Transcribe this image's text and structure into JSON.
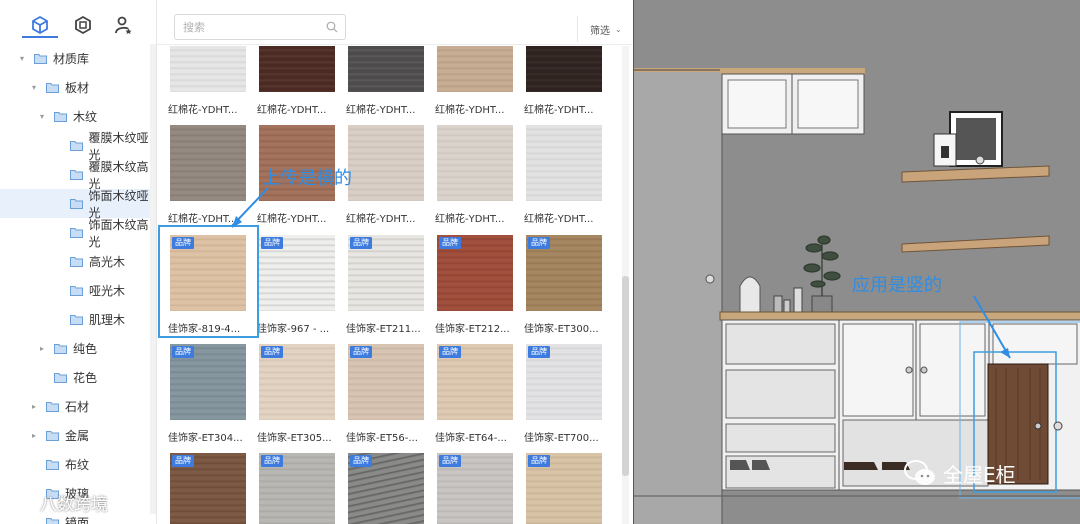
{
  "sidebar": {
    "tabs": [
      {
        "icon": "cube-icon",
        "active": true
      },
      {
        "icon": "hexagon-box-icon",
        "active": false
      },
      {
        "icon": "person-star-icon",
        "active": false
      }
    ],
    "tree": [
      {
        "label": "材质库",
        "level": 0,
        "arrow": "down"
      },
      {
        "label": "板材",
        "level": 1,
        "arrow": "down"
      },
      {
        "label": "木纹",
        "level": 2,
        "arrow": "down"
      },
      {
        "label": "覆膜木纹哑光",
        "level": 3,
        "arrow": ""
      },
      {
        "label": "覆膜木纹高光",
        "level": 3,
        "arrow": ""
      },
      {
        "label": "饰面木纹哑光",
        "level": 3,
        "arrow": "",
        "selected": true
      },
      {
        "label": "饰面木纹高光",
        "level": 3,
        "arrow": ""
      },
      {
        "label": "高光木",
        "level": 3,
        "arrow": ""
      },
      {
        "label": "哑光木",
        "level": 3,
        "arrow": ""
      },
      {
        "label": "肌理木",
        "level": 3,
        "arrow": ""
      },
      {
        "label": "纯色",
        "level": 2,
        "arrow": "right"
      },
      {
        "label": "花色",
        "level": 2,
        "arrow": ""
      },
      {
        "label": "石材",
        "level": 1,
        "arrow": "right"
      },
      {
        "label": "金属",
        "level": 1,
        "arrow": "right"
      },
      {
        "label": "布纹",
        "level": 1,
        "arrow": ""
      },
      {
        "label": "玻璃",
        "level": 1,
        "arrow": ""
      },
      {
        "label": "镜面",
        "level": 1,
        "arrow": ""
      }
    ]
  },
  "search": {
    "placeholder": "搜索",
    "value": ""
  },
  "filter": {
    "label": "筛选"
  },
  "badge_text": "品牌",
  "materials": {
    "rows": [
      [
        {
          "label": "红棉花-YDHT...",
          "color": "#e6e6e6",
          "grain": "#d6d6d6",
          "badge": false
        },
        {
          "label": "红棉花-YDHT...",
          "color": "#4a2a22",
          "grain": "#5c3a30",
          "badge": false
        },
        {
          "label": "红棉花-YDHT...",
          "color": "#4d4b4c",
          "grain": "#5e5c5d",
          "badge": false
        },
        {
          "label": "红棉花-YDHT...",
          "color": "#c7ad94",
          "grain": "#b89d83",
          "badge": false
        },
        {
          "label": "红棉花-YDHT...",
          "color": "#2e2320",
          "grain": "#3c302c",
          "badge": false
        }
      ],
      [
        {
          "label": "红棉花-YDHT...",
          "color": "#948a82",
          "grain": "#857b73",
          "badge": false
        },
        {
          "label": "红棉花-YDHT...",
          "color": "#a3735d",
          "grain": "#93634e",
          "badge": false
        },
        {
          "label": "红棉花-YDHT...",
          "color": "#d9cfc7",
          "grain": "#cbc1b9",
          "badge": false
        },
        {
          "label": "红棉花-YDHT...",
          "color": "#d9d3cc",
          "grain": "#ccc6bf",
          "badge": false
        },
        {
          "label": "红棉花-YDHT...",
          "color": "#e2e2e2",
          "grain": "#d4d4d4",
          "badge": false
        }
      ],
      [
        {
          "label": "佳饰家-819-4...",
          "color": "#dec2a5",
          "grain": "#cfb294",
          "badge": true
        },
        {
          "label": "佳饰家-967 - ...",
          "color": "#efefed",
          "grain": "#d0d0ce",
          "badge": true
        },
        {
          "label": "佳饰家-ET211...",
          "color": "#e8e6e3",
          "grain": "#cfcbc6",
          "badge": true
        },
        {
          "label": "佳饰家-ET212...",
          "color": "#a1503e",
          "grain": "#914232",
          "badge": true
        },
        {
          "label": "佳饰家-ET300...",
          "color": "#a58861",
          "grain": "#957851",
          "badge": true
        }
      ],
      [
        {
          "label": "佳饰家-ET304...",
          "color": "#8797a0",
          "grain": "#778790",
          "badge": true
        },
        {
          "label": "佳饰家-ET305...",
          "color": "#e2d3c2",
          "grain": "#d3c4b3",
          "badge": true
        },
        {
          "label": "佳饰家-ET56-...",
          "color": "#d7c4b2",
          "grain": "#c8b5a3",
          "badge": true
        },
        {
          "label": "佳饰家-ET64-...",
          "color": "#dec9b2",
          "grain": "#cfbaa3",
          "badge": true
        },
        {
          "label": "佳饰家-ET700...",
          "color": "#e2e2e4",
          "grain": "#d4d4d6",
          "badge": true
        }
      ],
      [
        {
          "label": "",
          "color": "#7c5a45",
          "grain": "#6c4a35",
          "badge": true
        },
        {
          "label": "",
          "color": "#b9b7b4",
          "grain": "#a9a7a4",
          "badge": true
        },
        {
          "label": "",
          "color": "#8a8a88",
          "grain": "#5f5f5d",
          "badge": true
        },
        {
          "label": "",
          "color": "#c9c5c3",
          "grain": "#b9b5b3",
          "badge": true
        },
        {
          "label": "",
          "color": "#d8c3a7",
          "grain": "#c8b397",
          "badge": true
        }
      ]
    ]
  },
  "annotations": {
    "upload": "上传是横的",
    "applied": "应用是竖的",
    "accent": "#2f8de4"
  },
  "watermarks": {
    "left": "八数跨境",
    "right": "全屋E柜"
  }
}
